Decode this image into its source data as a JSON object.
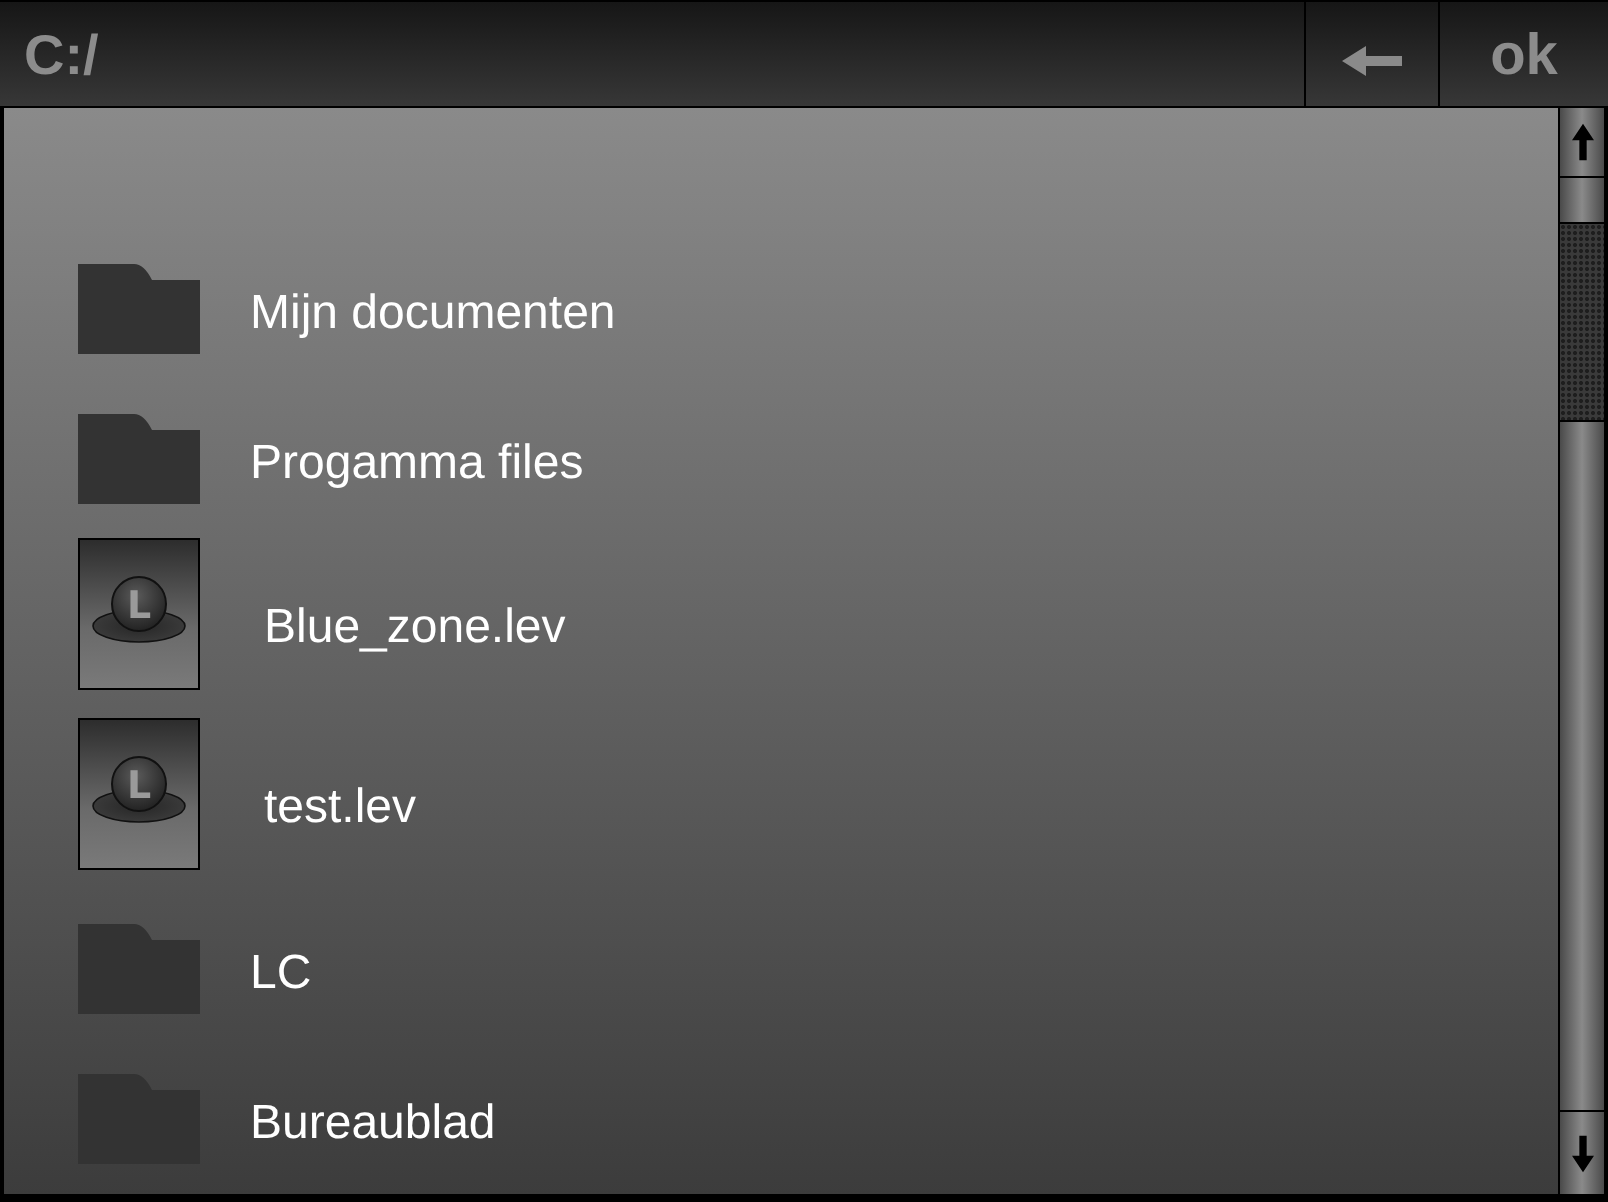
{
  "path_bar": {
    "path": "C:/"
  },
  "buttons": [
    {
      "kind": "back"
    },
    {
      "kind": "confirm",
      "label": "ok"
    }
  ],
  "items": [
    {
      "kind": "folder",
      "name": "Mijn documenten"
    },
    {
      "kind": "folder",
      "name": "Progamma files"
    },
    {
      "kind": "level",
      "name": "Blue_zone.lev",
      "icon_letter": "L"
    },
    {
      "kind": "level",
      "name": "test.lev",
      "icon_letter": "L"
    },
    {
      "kind": "folder",
      "name": "LC"
    },
    {
      "kind": "folder",
      "name": "Bureaublad"
    }
  ]
}
